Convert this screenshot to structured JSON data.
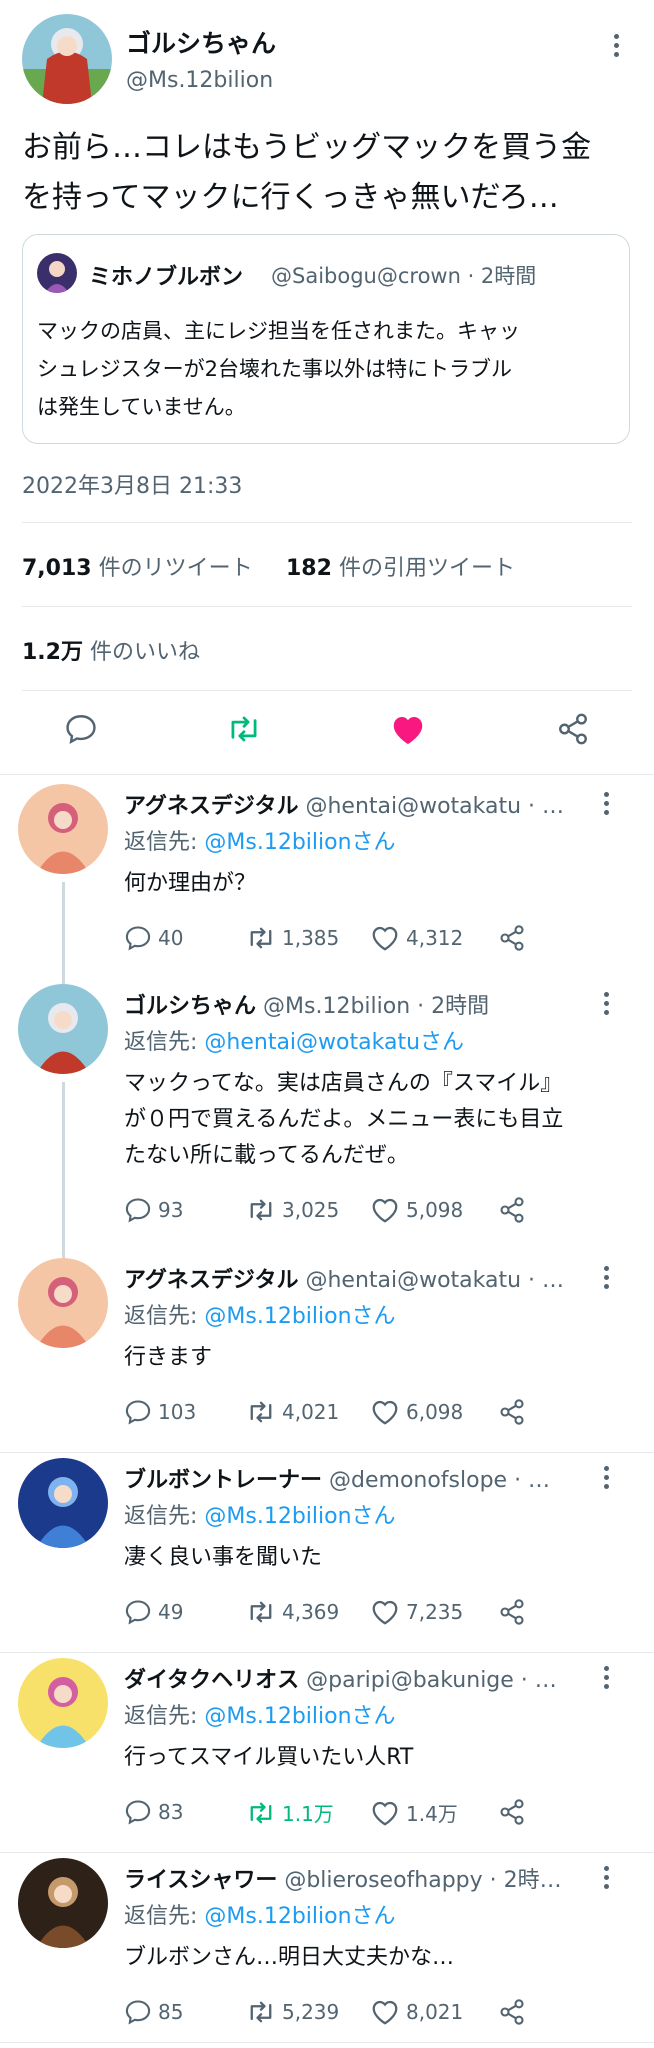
{
  "main_tweet": {
    "display_name": "ゴルシちゃん",
    "handle": "@Ms.12bilion",
    "text_line1": "お前ら…コレはもうビッグマックを買う金",
    "text_line2": "を持ってマックに行くっきゃ無いだろ…",
    "quote": {
      "display_name": "ミホノブルボン",
      "handle_time": "@Saibogu@crown · 2時間",
      "line1": "マックの店員、主にレジ担当を任されまた。キャッ",
      "line2": "シュレジスターが2台壊れた事以外は特にトラブル",
      "line3": "は発生していません。"
    },
    "timestamp": "2022年3月8日 21:33",
    "retweets_count": "7,013",
    "retweets_label": "件のリツイート",
    "quotes_count": "182",
    "quotes_label": "件の引用ツイート",
    "likes_count": "1.2万",
    "likes_label": "件のいいね"
  },
  "replies": [
    {
      "name": "アグネスデジタル",
      "meta": "@hentai@wotakatu · …",
      "reply_prefix": "返信先: ",
      "reply_to": "@Ms.12bilionさん",
      "lines": [
        "何か理由が？"
      ],
      "replies": "40",
      "retweets": "1,385",
      "likes": "4,312"
    },
    {
      "name": "ゴルシちゃん",
      "meta": "@Ms.12bilion · 2時間",
      "reply_prefix": "返信先: ",
      "reply_to": "@hentai@wotakatuさん",
      "lines": [
        "マックってな。実は店員さんの『スマイル』",
        "が０円で買えるんだよ。メニュー表にも目立",
        "たない所に載ってるんだぜ。"
      ],
      "replies": "93",
      "retweets": "3,025",
      "likes": "5,098"
    },
    {
      "name": "アグネスデジタル",
      "meta": "@hentai@wotakatu · …",
      "reply_prefix": "返信先: ",
      "reply_to": "@Ms.12bilionさん",
      "lines": [
        "行きます"
      ],
      "replies": "103",
      "retweets": "4,021",
      "likes": "6,098"
    },
    {
      "name": "ブルボントレーナー",
      "meta": "@demonofslope · …",
      "reply_prefix": "返信先: ",
      "reply_to": "@Ms.12bilionさん",
      "lines": [
        "凄く良い事を聞いた"
      ],
      "replies": "49",
      "retweets": "4,369",
      "likes": "7,235"
    },
    {
      "name": "ダイタクヘリオス",
      "meta": "@paripi@bakunige · …",
      "reply_prefix": "返信先: ",
      "reply_to": "@Ms.12bilionさん",
      "lines": [
        "行ってスマイル買いたい人RT"
      ],
      "replies": "83",
      "retweets": "1.1万",
      "likes": "1.4万"
    },
    {
      "name": "ライスシャワー",
      "meta": "@blieroseofhappy · 2時…",
      "reply_prefix": "返信先: ",
      "reply_to": "@Ms.12bilionさん",
      "lines": [
        "ブルボンさん…明日大丈夫かな…"
      ],
      "replies": "85",
      "retweets": "5,239",
      "likes": "8,021"
    }
  ],
  "colors": {
    "accent_blue": "#1d9bf0",
    "retweet_green": "#00ba7c",
    "like_pink": "#f91880",
    "muted": "#536471"
  }
}
